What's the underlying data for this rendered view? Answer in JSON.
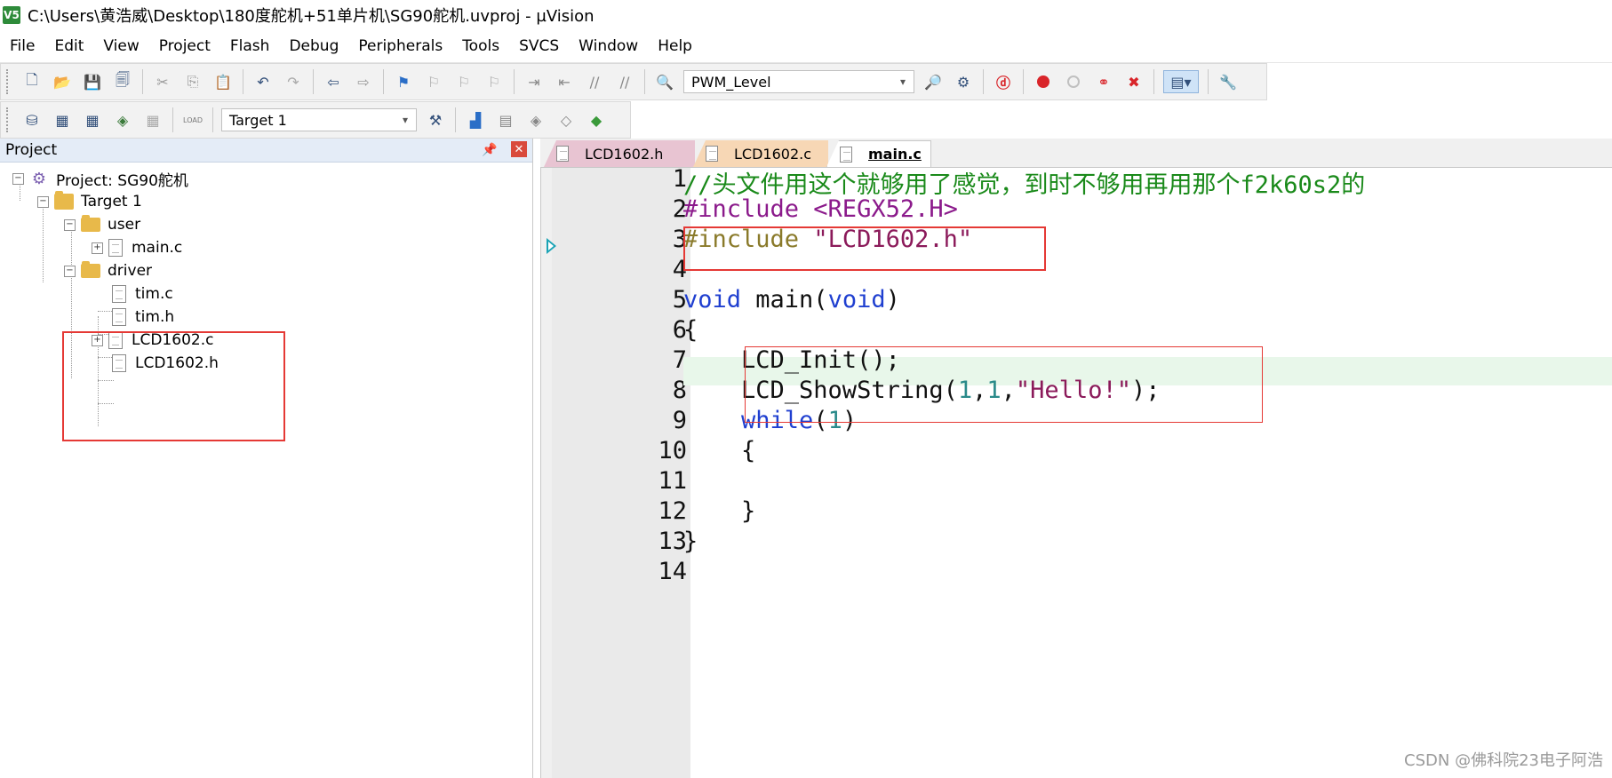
{
  "window": {
    "title": "C:\\Users\\黄浩威\\Desktop\\180度舵机+51单片机\\SG90舵机.uvproj - µVision",
    "app_icon_label": "V5"
  },
  "menu": [
    "File",
    "Edit",
    "View",
    "Project",
    "Flash",
    "Debug",
    "Peripherals",
    "Tools",
    "SVCS",
    "Window",
    "Help"
  ],
  "toolbar1": {
    "find_combo_value": "PWM_Level"
  },
  "toolbar2": {
    "target_combo_value": "Target 1",
    "load_label": "LOAD"
  },
  "project_panel": {
    "title": "Project",
    "tree": {
      "project": "Project: SG90舵机",
      "target": "Target 1",
      "groups": [
        {
          "name": "user",
          "files": [
            "main.c"
          ]
        },
        {
          "name": "driver",
          "files": [
            "tim.c",
            "tim.h",
            "LCD1602.c",
            "LCD1602.h"
          ]
        }
      ]
    }
  },
  "tabs": [
    {
      "label": "LCD1602.h",
      "active": false
    },
    {
      "label": "LCD1602.c",
      "active": false
    },
    {
      "label": "main.c",
      "active": true
    }
  ],
  "editor": {
    "line_numbers": [
      "1",
      "2",
      "3",
      "4",
      "5",
      "6",
      "7",
      "8",
      "9",
      "10",
      "11",
      "12",
      "13",
      "14"
    ],
    "lines": {
      "l1": "//头文件用这个就够用了感觉，到时不够用再用那个f2k60s2的",
      "l2": "#include <REGX52.H>",
      "l3_pre": "#include ",
      "l3_str": "\"LCD1602.h\"",
      "l5_kw1": "void",
      "l5_mid": " main(",
      "l5_kw2": "void",
      "l5_end": ")",
      "l6": "{",
      "l7": "    LCD_Init();",
      "l8_a": "    LCD_ShowString(",
      "l8_n1": "1",
      "l8_c": ",",
      "l8_n2": "1",
      "l8_c2": ",",
      "l8_str": "\"Hello!\"",
      "l8_end": ");",
      "l9_kw": "    while",
      "l9_a": "(",
      "l9_n": "1",
      "l9_b": ")",
      "l10": "    {",
      "l12": "    }",
      "l13": "}"
    }
  },
  "watermark": "CSDN @佛科院23电子阿浩"
}
